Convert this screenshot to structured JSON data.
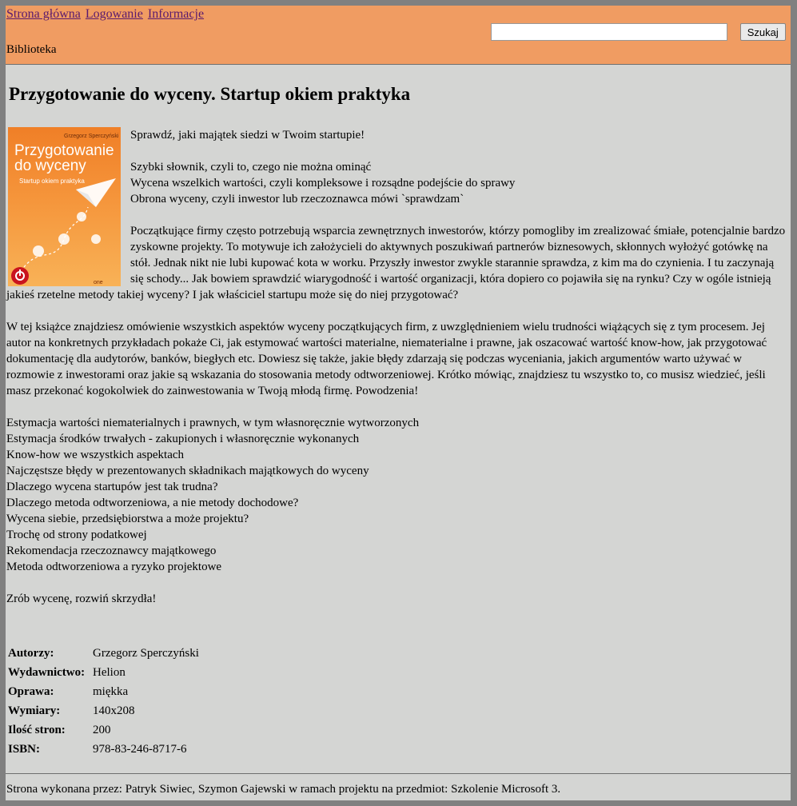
{
  "nav": {
    "home": "Strona główna",
    "login": "Logowanie",
    "info": "Informacje"
  },
  "search": {
    "value": "",
    "button": "Szukaj"
  },
  "site_name": "Biblioteka",
  "book": {
    "title": "Przygotowanie do wyceny. Startup okiem praktyka",
    "cover": {
      "author": "Grzegorz Sperczyński",
      "title_line1": "Przygotowanie",
      "title_line2": "do wyceny",
      "subtitle": "Startup okiem praktyka",
      "publisher_logo": "one"
    },
    "intro": "Sprawdź, jaki majątek siedzi w Twoim startupie!",
    "highlights": [
      "Szybki słownik, czyli to, czego nie można ominąć",
      "Wycena wszelkich wartości, czyli kompleksowe i rozsądne podejście do sprawy",
      "Obrona wyceny, czyli inwestor lub rzeczoznawca mówi `sprawdzam`"
    ],
    "paragraph1": "Początkujące firmy często potrzebują wsparcia zewnętrznych inwestorów, którzy pomogliby im zrealizować śmiałe, potencjalnie bardzo zyskowne projekty. To motywuje ich założycieli do aktywnych poszukiwań partnerów biznesowych, skłonnych wyłożyć gotówkę na stół. Jednak nikt nie lubi kupować kota w worku. Przyszły inwestor zwykle starannie sprawdza, z kim ma do czynienia. I tu zaczynają się schody... Jak bowiem sprawdzić wiarygodność i wartość organizacji, która dopiero co pojawiła się na rynku? Czy w ogóle istnieją jakieś rzetelne metody takiej wyceny? I jak właściciel startupu może się do niej przygotować?",
    "paragraph2": "W tej książce znajdziesz omówienie wszystkich aspektów wyceny początkujących firm, z uwzględnieniem wielu trudności wiążących się z tym procesem. Jej autor na konkretnych przykładach pokaże Ci, jak estymować wartości materialne, niematerialne i prawne, jak oszacować wartość know-how, jak przygotować dokumentację dla audytorów, banków, biegłych etc. Dowiesz się także, jakie błędy zdarzają się podczas wyceniania, jakich argumentów warto używać w rozmowie z inwestorami oraz jakie są wskazania do stosowania metody odtworzeniowej. Krótko mówiąc, znajdziesz tu wszystko to, co musisz wiedzieć, jeśli masz przekonać kogokolwiek do zainwestowania w Twoją młodą firmę. Powodzenia!",
    "topics": [
      "Estymacja wartości niematerialnych i prawnych, w tym własnoręcznie wytworzonych",
      "Estymacja środków trwałych - zakupionych i własnoręcznie wykonanych",
      "Know-how we wszystkich aspektach",
      "Najczęstsze błędy w prezentowanych składnikach majątkowych do wyceny",
      "Dlaczego wycena startupów jest tak trudna?",
      "Dlaczego metoda odtworzeniowa, a nie metody dochodowe?",
      "Wycena siebie, przedsiębiorstwa a może projektu?",
      "Trochę od strony podatkowej",
      "Rekomendacja rzeczoznawcy majątkowego",
      "Metoda odtworzeniowa a ryzyko projektowe"
    ],
    "closing": "Zrób wycenę, rozwiń skrzydła!",
    "details": [
      {
        "label": "Autorzy:",
        "value": "Grzegorz Sperczyński"
      },
      {
        "label": "Wydawnictwo:",
        "value": "Helion"
      },
      {
        "label": "Oprawa:",
        "value": "miękka"
      },
      {
        "label": "Wymiary:",
        "value": "140x208"
      },
      {
        "label": "Ilość stron:",
        "value": "200"
      },
      {
        "label": "ISBN:",
        "value": "978-83-246-8717-6"
      }
    ]
  },
  "footer": "Strona wykonana przez: Patryk Siwiec, Szymon Gajewski w ramach projektu na przedmiot: Szkolenie Microsoft 3.",
  "colors": {
    "header_bg": "#f09c62",
    "page_bg": "#d4d5d3",
    "frame_bg": "#808080",
    "link": "#5a1a6e"
  }
}
